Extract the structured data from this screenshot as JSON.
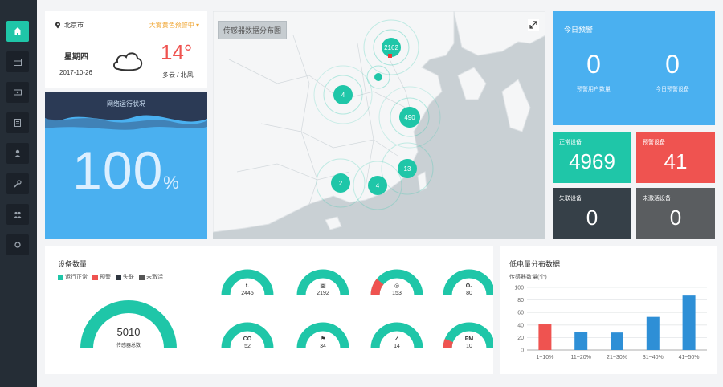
{
  "sidebar": {
    "items": [
      {
        "icon": "home-icon",
        "active": true
      },
      {
        "icon": "calendar-icon",
        "active": false
      },
      {
        "icon": "device-icon",
        "active": false
      },
      {
        "icon": "document-icon",
        "active": false
      },
      {
        "icon": "user-icon",
        "active": false
      },
      {
        "icon": "wrench-icon",
        "active": false
      },
      {
        "icon": "group-icon",
        "active": false
      },
      {
        "icon": "circle-icon",
        "active": false
      }
    ]
  },
  "weather": {
    "city": "北京市",
    "alert": "大雾黄色预警中 ▾",
    "day": "星期四",
    "date": "2017-10-26",
    "temperature": "14°",
    "condition": "多云 / 北风"
  },
  "network": {
    "title": "网络运行状况",
    "percent": "100",
    "unit": "%"
  },
  "map": {
    "title": "传感器数据分布图",
    "clusters": [
      {
        "label": "2162"
      },
      {
        "label": ""
      },
      {
        "label": "4"
      },
      {
        "label": "490"
      },
      {
        "label": "2"
      },
      {
        "label": "4"
      },
      {
        "label": "13"
      }
    ]
  },
  "today_warning": {
    "title": "今日预警",
    "users_value": "0",
    "users_label": "预警用户数量",
    "devices_value": "0",
    "devices_label": "今日预警设备"
  },
  "stats": {
    "normal": {
      "label": "正常设备",
      "value": "4969",
      "color": "#1fc6a8"
    },
    "warning": {
      "label": "预警设备",
      "value": "41",
      "color": "#ef5350"
    },
    "lost": {
      "label": "失联设备",
      "value": "0",
      "color": "#364048"
    },
    "inactive": {
      "label": "未激活设备",
      "value": "0",
      "color": "#5a5d60"
    }
  },
  "devices": {
    "title": "设备数量",
    "legend": [
      {
        "label": "运行正常",
        "color": "#1fc6a8"
      },
      {
        "label": "预警",
        "color": "#ef5350"
      },
      {
        "label": "失联",
        "color": "#2e3640"
      },
      {
        "label": "未激活",
        "color": "#555555"
      }
    ],
    "total_value": "5010",
    "total_label": "传感器总数",
    "gauges": [
      {
        "symbol": "t.",
        "value": "2445",
        "warn_fraction": 0
      },
      {
        "symbol": "回",
        "value": "2192",
        "warn_fraction": 0
      },
      {
        "symbol": "◎",
        "value": "153",
        "warn_fraction": 0.22
      },
      {
        "symbol": "O₂",
        "value": "80",
        "warn_fraction": 0
      },
      {
        "symbol": "CO",
        "value": "52",
        "warn_fraction": 0
      },
      {
        "symbol": "⚑",
        "value": "34",
        "warn_fraction": 0
      },
      {
        "symbol": "∠",
        "value": "14",
        "warn_fraction": 0
      },
      {
        "symbol": "PM",
        "value": "10",
        "warn_fraction": 0.12
      }
    ]
  },
  "chart_data": {
    "type": "bar",
    "title": "低电量分布数据",
    "ylabel": "传感器数量(个)",
    "categories": [
      "1~10%",
      "11~20%",
      "21~30%",
      "31~40%",
      "41~50%"
    ],
    "values": [
      41,
      29,
      28,
      53,
      87
    ],
    "colors": [
      "#ef5350",
      "#2e8fd6",
      "#2e8fd6",
      "#2e8fd6",
      "#2e8fd6"
    ],
    "ylim": [
      0,
      100
    ],
    "yticks": [
      "0",
      "20",
      "40",
      "60",
      "80",
      "100"
    ],
    "grid": true
  }
}
